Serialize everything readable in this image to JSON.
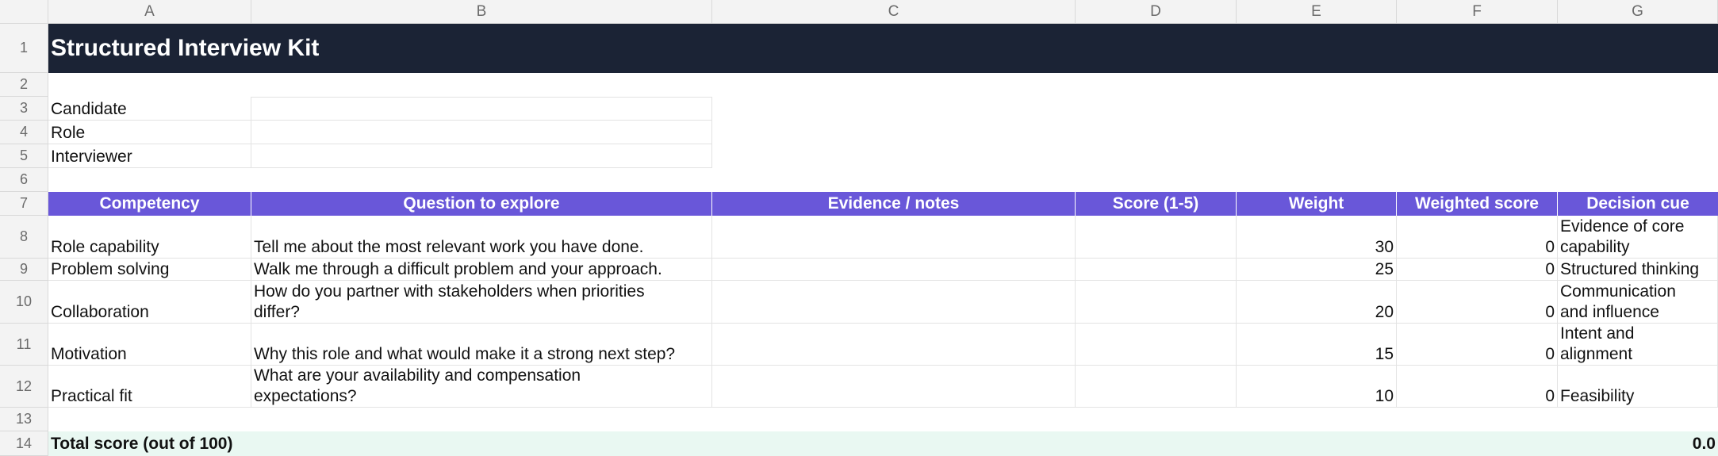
{
  "columns": [
    "A",
    "B",
    "C",
    "D",
    "E",
    "F",
    "G"
  ],
  "rows": [
    "1",
    "2",
    "3",
    "4",
    "5",
    "6",
    "7",
    "8",
    "9",
    "10",
    "11",
    "12",
    "13",
    "14"
  ],
  "title": "Structured Interview Kit",
  "info_labels": {
    "candidate": "Candidate",
    "role": "Role",
    "interviewer": "Interviewer"
  },
  "table_headers": {
    "competency": "Competency",
    "question": "Question to explore",
    "evidence": "Evidence / notes",
    "score": "Score (1-5)",
    "weight": "Weight",
    "weighted": "Weighted score",
    "cue": "Decision cue"
  },
  "competencies": [
    {
      "name": "Role capability",
      "q1": "Tell me about the most relevant work you have done.",
      "q2": "",
      "weight": "30",
      "weighted": "0",
      "cue1": "Evidence of core",
      "cue2": "capability"
    },
    {
      "name": "Problem solving",
      "q1": "Walk me through a difficult problem and your approach.",
      "q2": "",
      "weight": "25",
      "weighted": "0",
      "cue1": "Structured thinking",
      "cue2": ""
    },
    {
      "name": "Collaboration",
      "q1": "How do you partner with stakeholders when priorities",
      "q2": "differ?",
      "weight": "20",
      "weighted": "0",
      "cue1": "Communication",
      "cue2": "and influence"
    },
    {
      "name": "Motivation",
      "q1": "",
      "q2": "Why this role and what would make it a strong next step?",
      "weight": "15",
      "weighted": "0",
      "cue1": "Intent and",
      "cue2": "alignment"
    },
    {
      "name": "Practical fit",
      "q1": "What are your availability and compensation",
      "q2": "expectations?",
      "weight": "10",
      "weighted": "0",
      "cue1": "",
      "cue2": "Feasibility"
    }
  ],
  "total": {
    "label": "Total score (out of 100)",
    "value": "0.0"
  },
  "colors": {
    "title_bg": "#1b2335",
    "header_bg": "#6957d9",
    "total_bg": "#e9f8f2",
    "gridline": "#e3e3e3"
  }
}
